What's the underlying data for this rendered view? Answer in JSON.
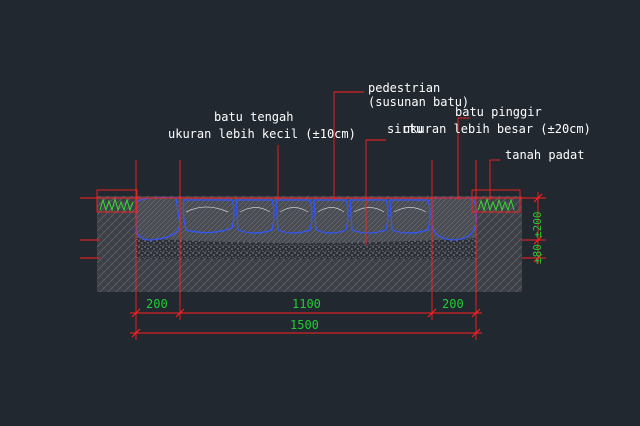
{
  "labels": {
    "pedestrian": "pedestrian",
    "susunan_batu": "(susunan batu)",
    "batu_tengah": "batu tengah",
    "ukuran_kecil": "ukuran lebih kecil (±10cm)",
    "batu_pinggir": "batu pinggir",
    "sirtu": "sirtu",
    "ukuran_besar": "ukuran lebih besar (±20cm)",
    "tanah_padat": "tanah padat"
  },
  "dimensions": {
    "left_width": "200",
    "middle_width": "1100",
    "right_width": "200",
    "total_width": "1500",
    "vertical_top": "±200",
    "vertical_bottom": "±80"
  },
  "colors": {
    "background": "#212830",
    "leader_red": "#ff2020",
    "dimension_green": "#22cc33",
    "stone_outline_blue": "#3355ff",
    "grass_green": "#33dd33",
    "label_white": "#ffffff"
  }
}
